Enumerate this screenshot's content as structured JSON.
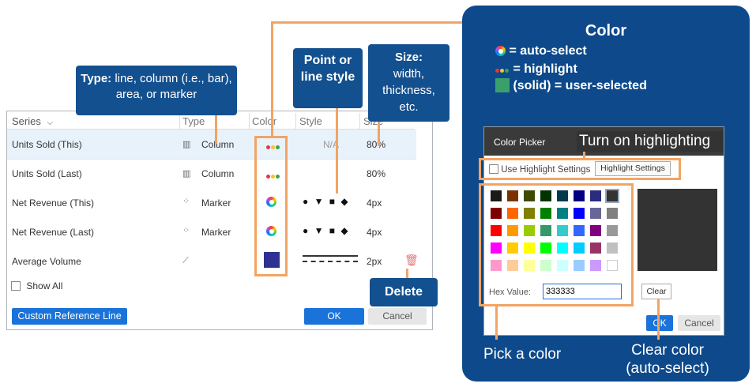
{
  "series_dialog": {
    "headers": {
      "series": "Series",
      "type": "Type",
      "color": "Color",
      "style": "Style",
      "size": "Size"
    },
    "rows": [
      {
        "name": "Units Sold (This)",
        "type": "Column",
        "color": "highlight",
        "style": "N/A",
        "size": "80%"
      },
      {
        "name": "Units Sold (Last)",
        "type": "Column",
        "color": "highlight",
        "style": "",
        "size": "80%"
      },
      {
        "name": "Net Revenue (This)",
        "type": "Marker",
        "color": "auto-select",
        "style": "● ▼ ■ ◆",
        "size": "4px"
      },
      {
        "name": "Net Revenue (Last)",
        "type": "Marker",
        "color": "auto-select",
        "style": "● ▼ ■ ◆",
        "size": "4px"
      },
      {
        "name": "Average Volume",
        "type": "",
        "color": "#2e3192",
        "style": "dashed",
        "size": "2px"
      }
    ],
    "show_all_label": "Show All",
    "custom_reference_line_label": "Custom Reference Line",
    "ok_label": "OK",
    "cancel_label": "Cancel"
  },
  "callouts": {
    "type_bold": "Type:",
    "type_text": " line, column (i.e., bar), area, or marker",
    "point_line_style": "Point or line style",
    "size_bold": "Size:",
    "size_text": "width, thickness, etc.",
    "delete": "Delete",
    "turn_on_highlighting": "Turn on highlighting",
    "pick_a_color": "Pick a color",
    "clear_color_line1": "Clear color",
    "clear_color_line2": "(auto-select)"
  },
  "legend": {
    "title": "Color",
    "auto_select": "= auto-select",
    "highlight": "= highlight",
    "user_selected": "(solid) = user-selected",
    "user_selected_color": "#3aa06b"
  },
  "color_picker": {
    "title": "Color Picker",
    "use_highlight_label": "Use Highlight Settings",
    "highlight_settings_button": "Highlight Settings",
    "hex_label": "Hex Value:",
    "hex_value": "333333",
    "clear_label": "Clear",
    "ok_label": "OK",
    "cancel_label": "Cancel",
    "preview_color": "#333333",
    "swatches": [
      [
        "#1a1a1a",
        "#7a3300",
        "#3f4a00",
        "#003300",
        "#003b4d",
        "#000080",
        "#2b2b80",
        "#333333"
      ],
      [
        "#800000",
        "#ff6600",
        "#808000",
        "#008000",
        "#008080",
        "#0000ff",
        "#666699",
        "#808080"
      ],
      [
        "#ff0000",
        "#ff9900",
        "#99cc00",
        "#339966",
        "#33cccc",
        "#3366ff",
        "#800080",
        "#999999"
      ],
      [
        "#ff00ff",
        "#ffcc00",
        "#ffff00",
        "#00ff00",
        "#00ffff",
        "#00ccff",
        "#993366",
        "#c0c0c0"
      ],
      [
        "#ff99cc",
        "#ffcc99",
        "#ffff99",
        "#ccffcc",
        "#ccffff",
        "#99ccff",
        "#cc99ff",
        "#ffffff"
      ]
    ]
  }
}
